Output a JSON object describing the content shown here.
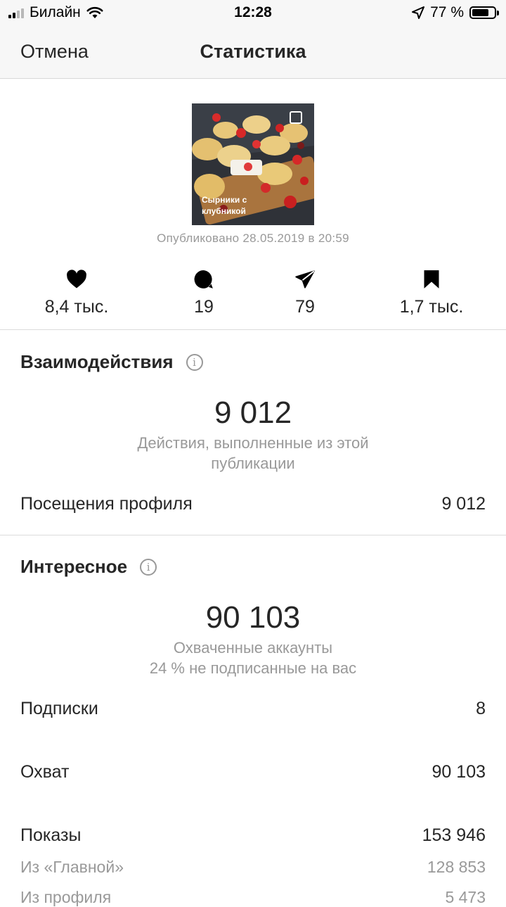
{
  "status_bar": {
    "carrier": "Билайн",
    "time": "12:28",
    "battery": "77 %",
    "battery_level": 0.77
  },
  "nav": {
    "cancel": "Отмена",
    "title": "Статистика"
  },
  "post": {
    "overlay_text_line1": "Сырники с",
    "overlay_text_line2": "клубникой",
    "published": "Опубликовано 28.05.2019 в 20:59"
  },
  "metrics": [
    {
      "icon": "heart-icon",
      "value": "8,4 тыс."
    },
    {
      "icon": "comment-icon",
      "value": "19"
    },
    {
      "icon": "send-icon",
      "value": "79"
    },
    {
      "icon": "bookmark-icon",
      "value": "1,7 тыс."
    }
  ],
  "interactions": {
    "title": "Взаимодействия",
    "total": "9 012",
    "description_line1": "Действия, выполненные из этой",
    "description_line2": "публикации",
    "profile_visits_label": "Посещения профиля",
    "profile_visits_value": "9 012"
  },
  "discovery": {
    "title": "Интересное",
    "total": "90 103",
    "description_line1": "Охваченные аккаунты",
    "description_line2": "24 % не подписанные на вас",
    "rows": [
      {
        "label": "Подписки",
        "value": "8"
      },
      {
        "label": "Охват",
        "value": "90 103"
      },
      {
        "label": "Показы",
        "value": "153 946"
      },
      {
        "label": "Из «Главной»",
        "value": "128 853"
      },
      {
        "label": "Из профиля",
        "value": "5 473"
      }
    ]
  }
}
